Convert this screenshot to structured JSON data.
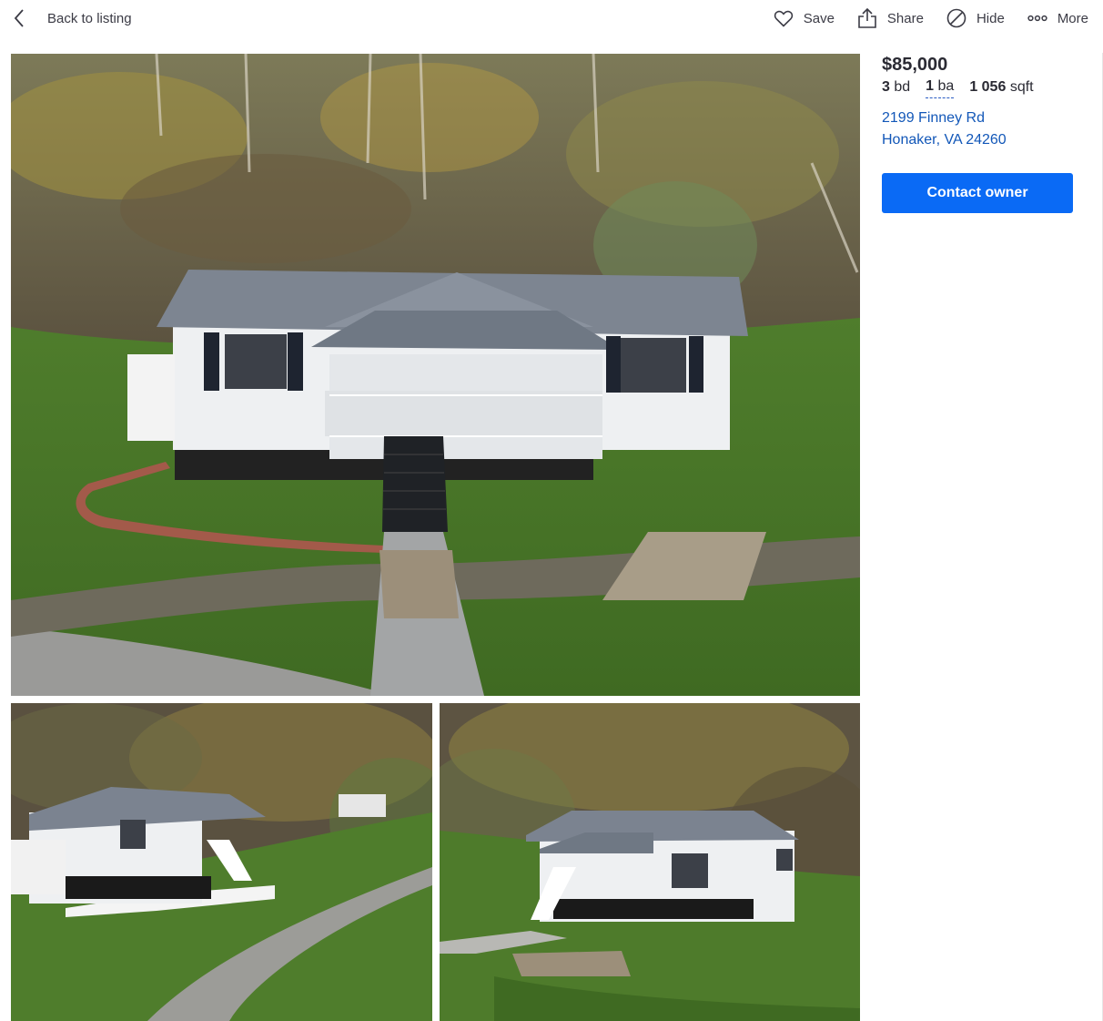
{
  "topbar": {
    "back_label": "Back to listing",
    "actions": {
      "save": "Save",
      "share": "Share",
      "hide": "Hide",
      "more": "More"
    }
  },
  "listing": {
    "price": "$85,000",
    "beds": "3",
    "beds_unit": "bd",
    "baths": "1",
    "baths_unit": "ba",
    "sqft": "1 056",
    "sqft_unit": "sqft",
    "address_line1": "2199 Finney Rd",
    "address_line2": "Honaker, VA 24260",
    "contact_label": "Contact owner"
  },
  "photos": [
    {
      "subject": "main-house-front-photo"
    },
    {
      "subject": "house-side-driveway-photo"
    },
    {
      "subject": "house-side-bridge-photo"
    }
  ],
  "colors": {
    "accent": "#0a6af5",
    "link": "#1257b8",
    "text": "#2a2a33"
  },
  "icons": [
    "chevron-left-icon",
    "heart-icon",
    "share-icon",
    "hide-icon",
    "more-dots-icon"
  ]
}
